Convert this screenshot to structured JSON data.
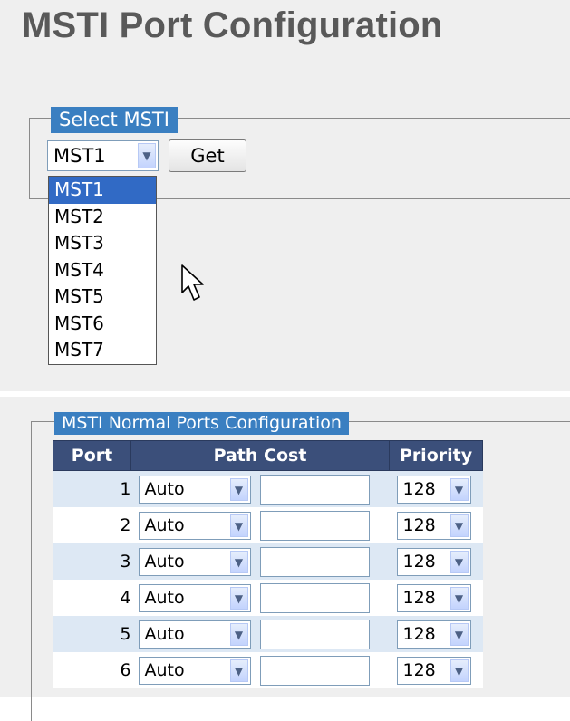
{
  "page_title": "MSTI Port Configuration",
  "select_msti": {
    "legend": "Select MSTI",
    "selected": "MST1",
    "get_button": "Get",
    "options": [
      "MST1",
      "MST2",
      "MST3",
      "MST4",
      "MST5",
      "MST6",
      "MST7"
    ]
  },
  "normal_ports": {
    "legend": "MSTI Normal Ports Configuration",
    "headers": {
      "port": "Port",
      "path_cost": "Path Cost",
      "priority": "Priority"
    },
    "rows": [
      {
        "port": "1",
        "path_cost_mode": "Auto",
        "path_cost_value": "",
        "priority": "128"
      },
      {
        "port": "2",
        "path_cost_mode": "Auto",
        "path_cost_value": "",
        "priority": "128"
      },
      {
        "port": "3",
        "path_cost_mode": "Auto",
        "path_cost_value": "",
        "priority": "128"
      },
      {
        "port": "4",
        "path_cost_mode": "Auto",
        "path_cost_value": "",
        "priority": "128"
      },
      {
        "port": "5",
        "path_cost_mode": "Auto",
        "path_cost_value": "",
        "priority": "128"
      },
      {
        "port": "6",
        "path_cost_mode": "Auto",
        "path_cost_value": "",
        "priority": "128"
      }
    ]
  },
  "colors": {
    "legend_bg": "#3a7fc1",
    "table_header_bg": "#3b4f7a",
    "row_alt_bg": "#dde8f4",
    "selected_option_bg": "#316ac5"
  }
}
